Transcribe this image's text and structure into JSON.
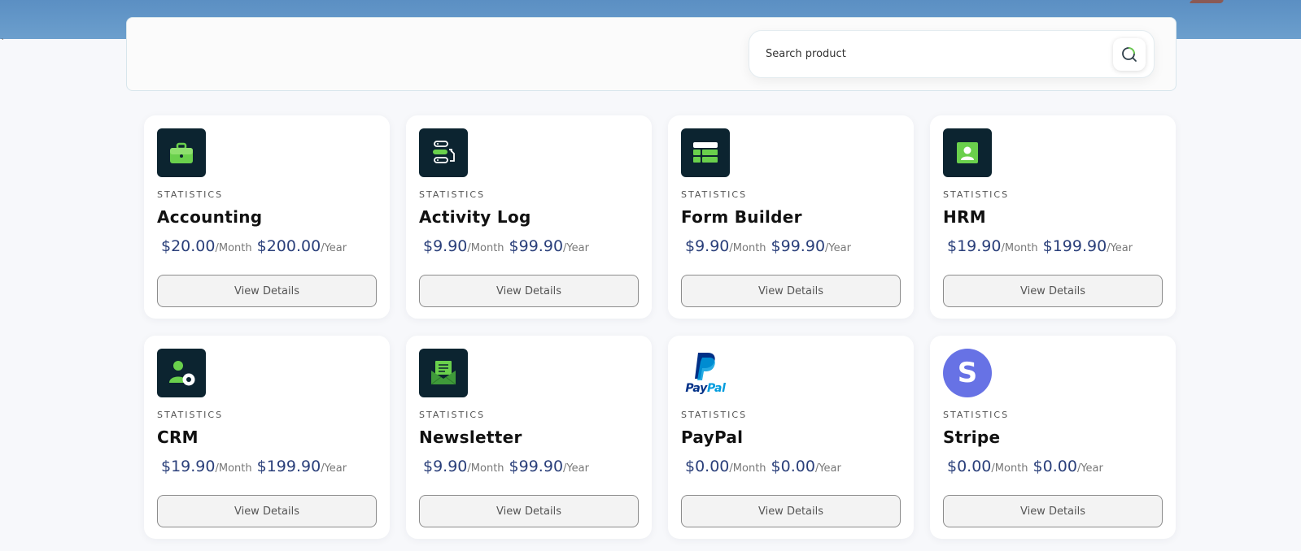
{
  "header": {
    "tick": "`"
  },
  "search": {
    "placeholder": "Search product"
  },
  "colors": {
    "accent_green": "#6ad04c",
    "icon_bg": "#0c2430",
    "price_blue": "#2a3f7a",
    "stripe_purple": "#6772e5",
    "paypal_dark": "#003087",
    "paypal_light": "#009cde"
  },
  "products": [
    {
      "icon": "briefcase-icon",
      "category": "STATISTICS",
      "name": "Accounting",
      "monthly": "$20.00",
      "monthly_unit": "/Month",
      "yearly": "$200.00",
      "yearly_unit": "/Year",
      "button": "View Details"
    },
    {
      "icon": "activity-log-icon",
      "category": "STATISTICS",
      "name": "Activity Log",
      "monthly": "$9.90",
      "monthly_unit": "/Month",
      "yearly": "$99.90",
      "yearly_unit": "/Year",
      "button": "View Details"
    },
    {
      "icon": "form-builder-icon",
      "category": "STATISTICS",
      "name": "Form Builder",
      "monthly": "$9.90",
      "monthly_unit": "/Month",
      "yearly": "$99.90",
      "yearly_unit": "/Year",
      "button": "View Details"
    },
    {
      "icon": "id-card-icon",
      "category": "STATISTICS",
      "name": "HRM",
      "monthly": "$19.90",
      "monthly_unit": "/Month",
      "yearly": "$199.90",
      "yearly_unit": "/Year",
      "button": "View Details"
    },
    {
      "icon": "user-eye-icon",
      "category": "STATISTICS",
      "name": "CRM",
      "monthly": "$19.90",
      "monthly_unit": "/Month",
      "yearly": "$199.90",
      "yearly_unit": "/Year",
      "button": "View Details"
    },
    {
      "icon": "envelope-letter-icon",
      "category": "STATISTICS",
      "name": "Newsletter",
      "monthly": "$9.90",
      "monthly_unit": "/Month",
      "yearly": "$99.90",
      "yearly_unit": "/Year",
      "button": "View Details"
    },
    {
      "icon": "paypal-logo-icon",
      "logo_text": "PayPal",
      "category": "STATISTICS",
      "name": "PayPal",
      "monthly": "$0.00",
      "monthly_unit": "/Month",
      "yearly": "$0.00",
      "yearly_unit": "/Year",
      "button": "View Details"
    },
    {
      "icon": "stripe-logo-icon",
      "logo_text": "S",
      "category": "STATISTICS",
      "name": "Stripe",
      "monthly": "$0.00",
      "monthly_unit": "/Month",
      "yearly": "$0.00",
      "yearly_unit": "/Year",
      "button": "View Details"
    }
  ]
}
